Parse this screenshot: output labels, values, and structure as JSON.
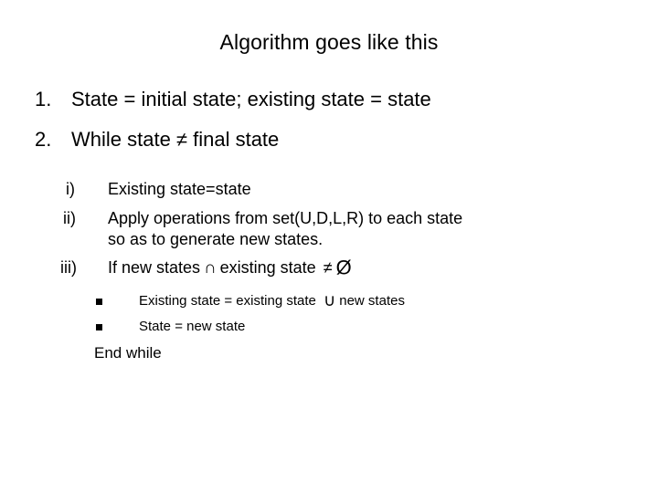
{
  "slide": {
    "title": "Algorithm goes like this",
    "background_color": "#ffffff",
    "text_color": "#000000"
  },
  "outline": {
    "level1": [
      {
        "marker": "1.",
        "text": "State = initial state; existing state = state"
      },
      {
        "marker": "2.",
        "text": "While state ≠ final state"
      }
    ],
    "level2": [
      {
        "marker": "i)",
        "text": "Existing state=state",
        "continuation": ""
      },
      {
        "marker": "ii)",
        "text": "Apply operations from set(U,D,L,R) to each state",
        "continuation": "so as to generate new states."
      },
      {
        "marker": "iii)",
        "text_before_op": "If new states",
        "op_intersection": "∩",
        "text_middle": "existing state",
        "op_not_equal": "≠",
        "op_empty_set": "Ø"
      }
    ],
    "level3": [
      {
        "bullet": "square-bullet",
        "text_before_op": "Existing state = existing state",
        "op_union": "∪",
        "text_after_op": "new states"
      },
      {
        "bullet": "square-bullet",
        "text_before_op": "State = new state",
        "op_union": "",
        "text_after_op": ""
      }
    ],
    "closing_line": "End while"
  }
}
